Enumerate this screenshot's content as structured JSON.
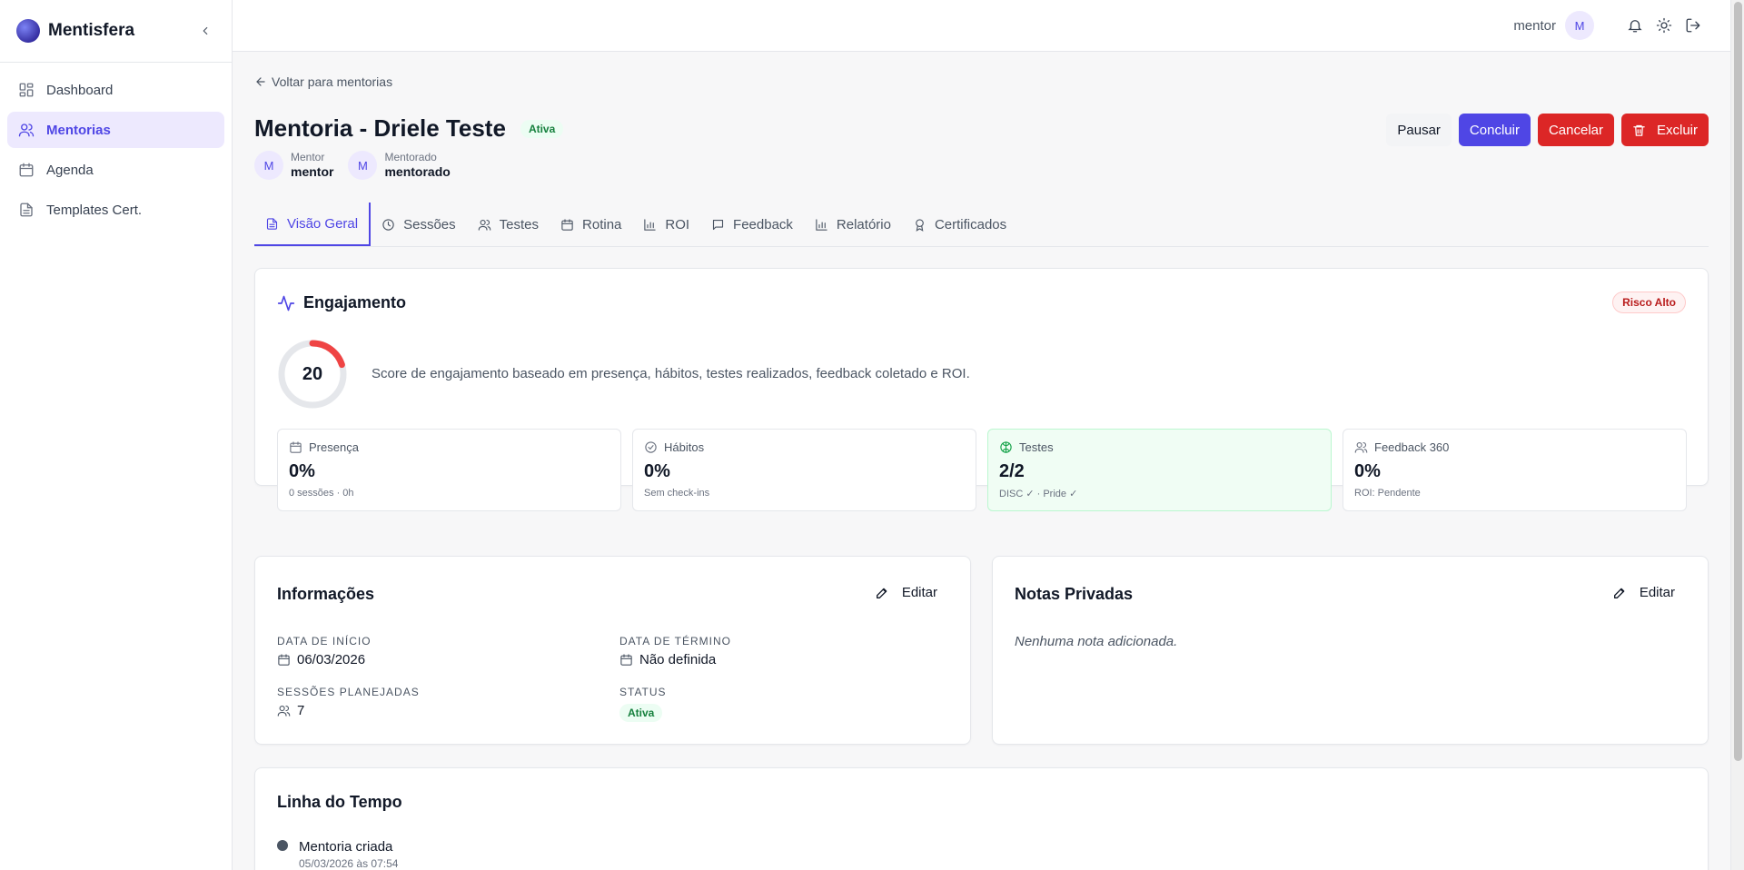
{
  "app": {
    "name": "Mentisfera"
  },
  "sidebar": {
    "items": [
      {
        "label": "Dashboard",
        "icon": "dashboard-icon"
      },
      {
        "label": "Mentorias",
        "icon": "users-icon",
        "active": true
      },
      {
        "label": "Agenda",
        "icon": "calendar-icon"
      },
      {
        "label": "Templates Cert.",
        "icon": "file-icon"
      }
    ]
  },
  "topbar": {
    "username": "mentor",
    "avatar_initial": "M"
  },
  "back_link": "Voltar para mentorias",
  "mentoria": {
    "title": "Mentoria - Driele Teste",
    "status_badge": "Ativa",
    "mentor": {
      "role": "Mentor",
      "name": "mentor",
      "initial": "M"
    },
    "mentorado": {
      "role": "Mentorado",
      "name": "mentorado",
      "initial": "M"
    }
  },
  "actions": {
    "pause": "Pausar",
    "finish": "Concluir",
    "cancel": "Cancelar",
    "delete": "Excluir"
  },
  "tabs": [
    "Visão Geral",
    "Sessões",
    "Testes",
    "Rotina",
    "ROI",
    "Feedback",
    "Relatório",
    "Certificados"
  ],
  "engagement": {
    "title": "Engajamento",
    "risk_badge": "Risco Alto",
    "score": "20",
    "score_fraction": 0.2,
    "description": "Score de engajamento baseado em presença, hábitos, testes realizados, feedback coletado e ROI.",
    "metrics": [
      {
        "label": "Presença",
        "value": "0%",
        "sub": "0 sessões · 0h"
      },
      {
        "label": "Hábitos",
        "value": "0%",
        "sub": "Sem check-ins"
      },
      {
        "label": "Testes",
        "value": "2/2",
        "sub": "DISC ✓ · Pride ✓"
      },
      {
        "label": "Feedback 360",
        "value": "0%",
        "sub": "ROI: Pendente"
      }
    ]
  },
  "info": {
    "title": "Informações",
    "edit": "Editar",
    "start_label": "DATA DE INÍCIO",
    "start_value": "06/03/2026",
    "end_label": "DATA DE TÉRMINO",
    "end_value": "Não definida",
    "sessions_label": "SESSÕES PLANEJADAS",
    "sessions_value": "7",
    "status_label": "STATUS",
    "status_value": "Ativa"
  },
  "notes": {
    "title": "Notas Privadas",
    "edit": "Editar",
    "empty": "Nenhuma nota adicionada."
  },
  "timeline": {
    "title": "Linha do Tempo",
    "events": [
      {
        "title": "Mentoria criada",
        "date": "05/03/2026 às 07:54"
      }
    ]
  },
  "colors": {
    "accent": "#4f46e5",
    "danger": "#dc2626",
    "success": "#15803d",
    "gauge": "#ef4444"
  }
}
